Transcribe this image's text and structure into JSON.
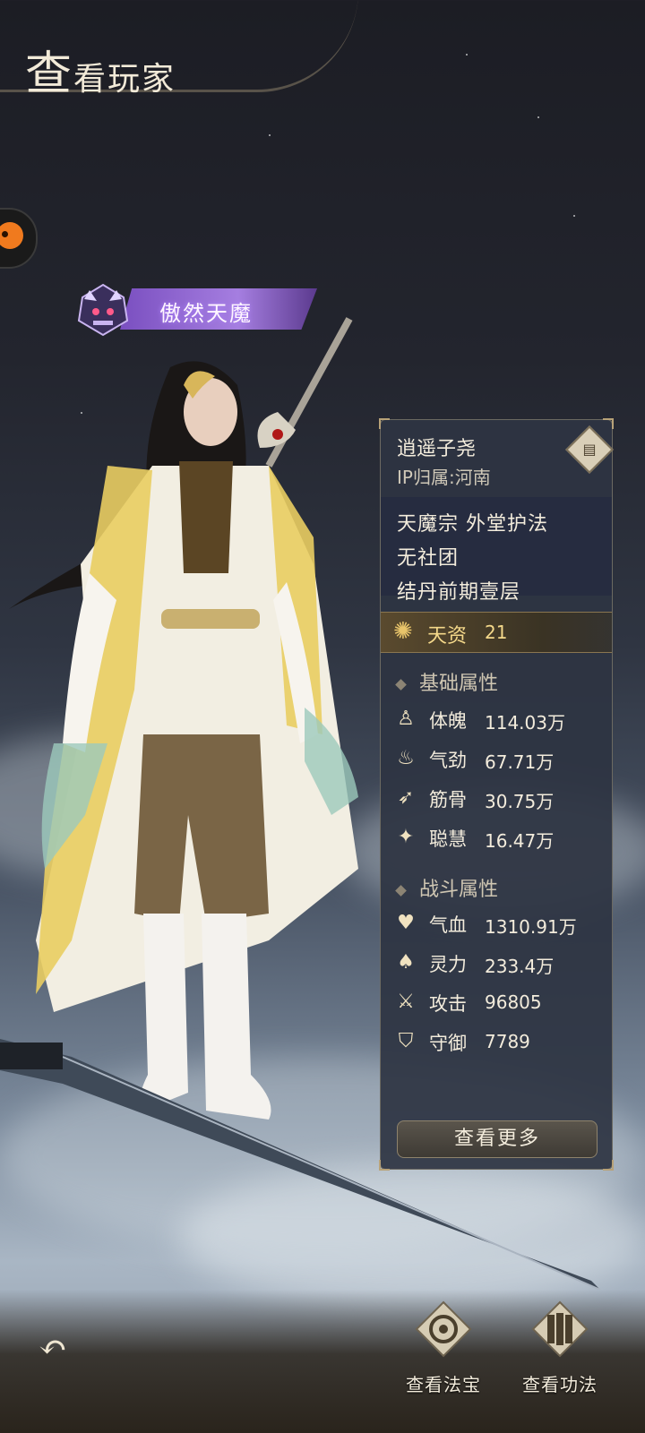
{
  "header": {
    "title_big": "查",
    "title_rest": "看玩家"
  },
  "title_badge": {
    "text": "傲然天魔"
  },
  "player": {
    "name": "逍遥子尧",
    "ip_location": "IP归属:河南",
    "sect_role": "天魔宗 外堂护法",
    "guild": "无社团",
    "realm": "结丹前期壹层"
  },
  "talent": {
    "label": "天资",
    "value": "21"
  },
  "basic_section": {
    "title": "基础属性",
    "stats": [
      {
        "label": "体魄",
        "value": "114.03万",
        "icon": "meditation-icon"
      },
      {
        "label": "气劲",
        "value": "67.71万",
        "icon": "flame-swirl-icon"
      },
      {
        "label": "筋骨",
        "value": "30.75万",
        "icon": "feather-blade-icon"
      },
      {
        "label": "聪慧",
        "value": "16.47万",
        "icon": "sparkle-icon"
      }
    ]
  },
  "battle_section": {
    "title": "战斗属性",
    "stats": [
      {
        "label": "气血",
        "value": "1310.91万",
        "icon": "heart-icon"
      },
      {
        "label": "灵力",
        "value": "233.4万",
        "icon": "spirit-flame-icon"
      },
      {
        "label": "攻击",
        "value": "96805",
        "icon": "crossed-swords-icon"
      },
      {
        "label": "守御",
        "value": "7789",
        "icon": "shield-icon"
      }
    ]
  },
  "more_button": "查看更多",
  "bottom": {
    "artifact_label": "查看法宝",
    "skills_label": "查看功法"
  },
  "colors": {
    "accent_gold": "#f4d88a",
    "badge_purple": "#a57ee0",
    "panel_bg": "#2e3442"
  }
}
